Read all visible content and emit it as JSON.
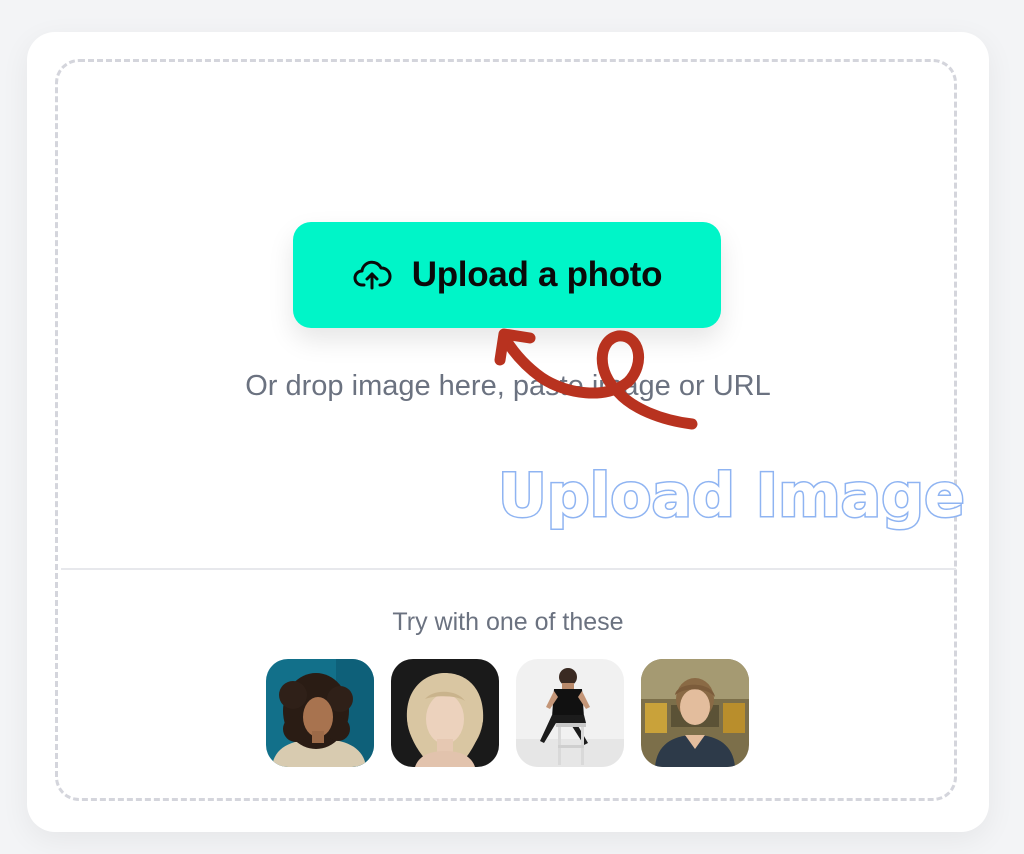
{
  "upload": {
    "button_label": "Upload a photo",
    "icon": "cloud-upload-icon"
  },
  "dropzone": {
    "hint": "Or drop image here, paste image or URL"
  },
  "samples": {
    "label": "Try with one of these",
    "items": [
      {
        "name": "sample-photo-1"
      },
      {
        "name": "sample-photo-2"
      },
      {
        "name": "sample-photo-3"
      },
      {
        "name": "sample-photo-4"
      }
    ]
  },
  "annotation": {
    "text": "Upload Image",
    "arrow_color": "#b8321f",
    "text_color": "#8fb4f2"
  },
  "colors": {
    "accent": "#00f5c8",
    "muted_text": "#6b7280"
  }
}
